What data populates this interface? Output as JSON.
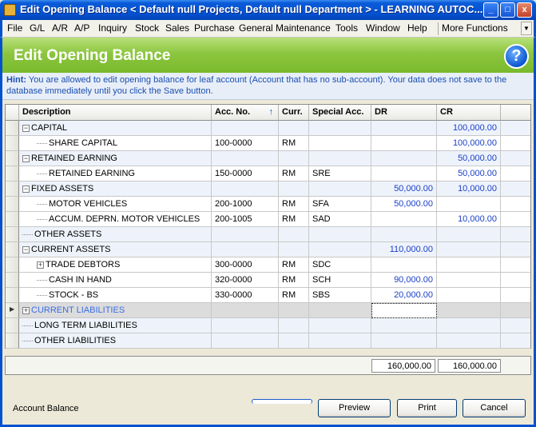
{
  "window": {
    "title": "Edit Opening Balance < Default null Projects, Default null Department > - LEARNING AUTOC...",
    "controls": [
      "_",
      "□",
      "x"
    ]
  },
  "menu": {
    "items": [
      "File",
      "G/L",
      "A/R",
      "A/P",
      "Inquiry",
      "Stock",
      "Sales",
      "Purchase",
      "General Maintenance",
      "Tools",
      "Window",
      "Help"
    ],
    "more": "More Functions"
  },
  "header": {
    "title": "Edit Opening Balance",
    "help_icon": "?"
  },
  "hint": {
    "label": "Hint:",
    "text": "You are allowed to edit opening balance for leaf account (Account that has no sub-account). Your data does not save to the database immediately until you click the Save button."
  },
  "grid": {
    "columns": [
      "Description",
      "Acc. No.",
      "Curr.",
      "Special Acc.",
      "DR",
      "CR"
    ],
    "sort_indicator": "↑",
    "rows": [
      {
        "desc": "CAPITAL",
        "level": 0,
        "expander": "−",
        "acc": "",
        "curr": "",
        "special": "",
        "dr": "",
        "cr": "100,000.00"
      },
      {
        "desc": "SHARE CAPITAL",
        "level": 1,
        "expander": "",
        "acc": "100-0000",
        "curr": "RM",
        "special": "",
        "dr": "",
        "cr": "100,000.00"
      },
      {
        "desc": "RETAINED EARNING",
        "level": 0,
        "expander": "−",
        "acc": "",
        "curr": "",
        "special": "",
        "dr": "",
        "cr": "50,000.00"
      },
      {
        "desc": "RETAINED EARNING",
        "level": 1,
        "expander": "",
        "acc": "150-0000",
        "curr": "RM",
        "special": "SRE",
        "dr": "",
        "cr": "50,000.00"
      },
      {
        "desc": "FIXED ASSETS",
        "level": 0,
        "expander": "−",
        "acc": "",
        "curr": "",
        "special": "",
        "dr": "50,000.00",
        "cr": "10,000.00"
      },
      {
        "desc": "MOTOR VEHICLES",
        "level": 1,
        "expander": "",
        "acc": "200-1000",
        "curr": "RM",
        "special": "SFA",
        "dr": "50,000.00",
        "cr": ""
      },
      {
        "desc": "ACCUM. DEPRN. MOTOR VEHICLES",
        "level": 1,
        "expander": "",
        "acc": "200-1005",
        "curr": "RM",
        "special": "SAD",
        "dr": "",
        "cr": "10,000.00"
      },
      {
        "desc": "OTHER ASSETS",
        "level": 0,
        "expander": "",
        "acc": "",
        "curr": "",
        "special": "",
        "dr": "",
        "cr": ""
      },
      {
        "desc": "CURRENT ASSETS",
        "level": 0,
        "expander": "−",
        "acc": "",
        "curr": "",
        "special": "",
        "dr": "110,000.00",
        "cr": ""
      },
      {
        "desc": "TRADE DEBTORS",
        "level": 1,
        "expander": "+",
        "acc": "300-0000",
        "curr": "RM",
        "special": "SDC",
        "dr": "",
        "cr": ""
      },
      {
        "desc": "CASH IN HAND",
        "level": 1,
        "expander": "",
        "acc": "320-0000",
        "curr": "RM",
        "special": "SCH",
        "dr": "90,000.00",
        "cr": ""
      },
      {
        "desc": "STOCK - BS",
        "level": 1,
        "expander": "",
        "acc": "330-0000",
        "curr": "RM",
        "special": "SBS",
        "dr": "20,000.00",
        "cr": ""
      },
      {
        "desc": "CURRENT LIABILITIES",
        "level": 0,
        "expander": "+",
        "acc": "",
        "curr": "",
        "special": "",
        "dr": "",
        "cr": "",
        "active": true
      },
      {
        "desc": "LONG TERM LIABILITIES",
        "level": 0,
        "expander": "",
        "acc": "",
        "curr": "",
        "special": "",
        "dr": "",
        "cr": ""
      },
      {
        "desc": "OTHER LIABILITIES",
        "level": 0,
        "expander": "",
        "acc": "",
        "curr": "",
        "special": "",
        "dr": "",
        "cr": ""
      }
    ]
  },
  "totals": {
    "dr": "160,000.00",
    "cr": "160,000.00"
  },
  "footer": {
    "label": "Account Balance",
    "buttons": [
      "Preview",
      "Print",
      "Cancel"
    ]
  }
}
